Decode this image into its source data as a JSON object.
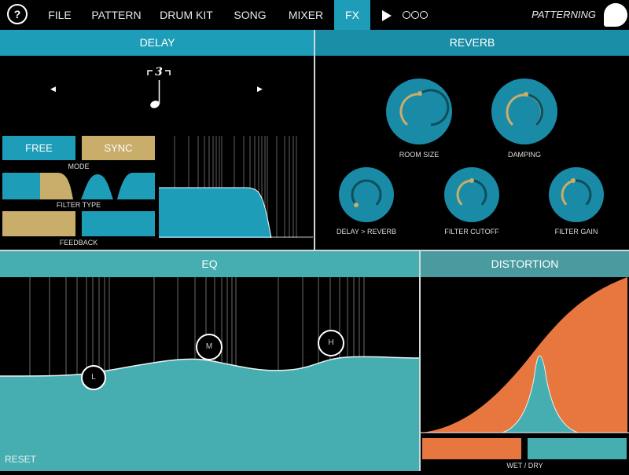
{
  "topbar": {
    "help_label": "?",
    "menu": [
      "FILE",
      "PATTERN",
      "DRUM KIT",
      "SONG",
      "MIXER",
      "FX"
    ],
    "active": "FX",
    "brand": "PATTERNING"
  },
  "delay": {
    "title": "DELAY",
    "note_value": "3",
    "mode": {
      "free": "FREE",
      "sync": "SYNC",
      "label": "MODE"
    },
    "filter_type_label": "FILTER TYPE",
    "feedback_label": "FEEDBACK"
  },
  "reverb": {
    "title": "REVERB",
    "knobs": [
      {
        "label": "ROOM SIZE"
      },
      {
        "label": "DAMPING"
      },
      {
        "label": "DELAY > REVERB"
      },
      {
        "label": "FILTER CUTOFF"
      },
      {
        "label": "FILTER GAIN"
      }
    ]
  },
  "eq": {
    "title": "EQ",
    "reset": "RESET",
    "handles": [
      "L",
      "M",
      "H"
    ]
  },
  "distortion": {
    "title": "DISTORTION",
    "wet_dry_label": "WET / DRY"
  },
  "colors": {
    "blue": "#1e9db8",
    "teal": "#46aeb0",
    "gold": "#c9ad6a",
    "orange": "#e8773f",
    "knob": "#1a8ba6"
  }
}
